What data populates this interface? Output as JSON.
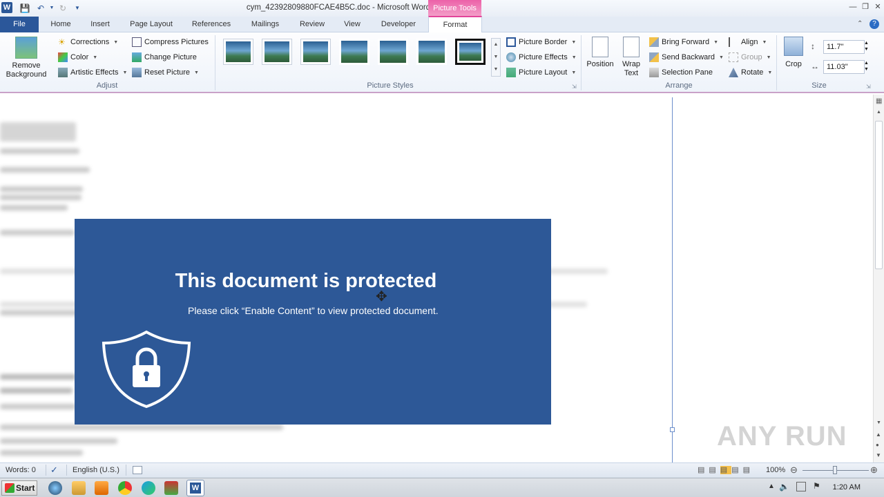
{
  "window": {
    "title": "cym_42392809880FCAE4B5C.doc - Microsoft Word",
    "contextual_tab": "Picture Tools"
  },
  "tabs": [
    "File",
    "Home",
    "Insert",
    "Page Layout",
    "References",
    "Mailings",
    "Review",
    "View",
    "Developer",
    "Format"
  ],
  "ribbon": {
    "adjust": {
      "remove_background": "Remove Background",
      "corrections": "Corrections",
      "color": "Color",
      "artistic_effects": "Artistic Effects",
      "compress": "Compress Pictures",
      "change": "Change Picture",
      "reset": "Reset Picture",
      "label": "Adjust"
    },
    "styles": {
      "label": "Picture Styles",
      "border": "Picture Border",
      "effects": "Picture Effects",
      "layout": "Picture Layout"
    },
    "arrange": {
      "label": "Arrange",
      "position": "Position",
      "wrap_text": "Wrap Text",
      "bring_forward": "Bring Forward",
      "send_backward": "Send Backward",
      "selection_pane": "Selection Pane",
      "align": "Align",
      "group": "Group",
      "rotate": "Rotate"
    },
    "size": {
      "label": "Size",
      "crop": "Crop",
      "height": "11.7\"",
      "width": "11.03\""
    }
  },
  "document": {
    "banner_title": "This document is protected",
    "banner_subtitle": "Please click “Enable Content” to view protected document."
  },
  "status": {
    "words": "Words: 0",
    "language": "English (U.S.)",
    "zoom": "100%"
  },
  "taskbar": {
    "start": "Start",
    "time": "1:20 AM"
  },
  "watermark": "ANY RUN"
}
